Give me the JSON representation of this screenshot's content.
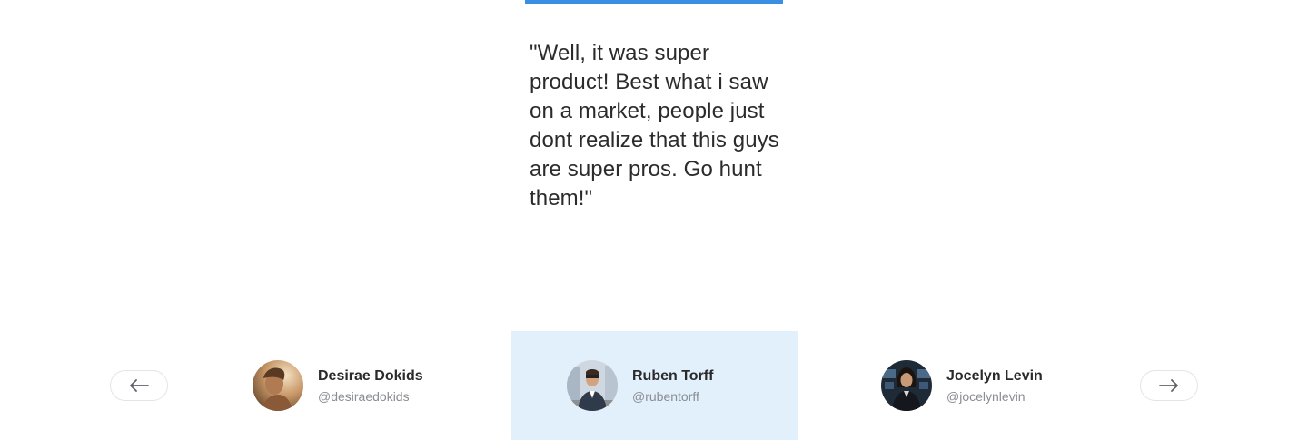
{
  "testimonial": {
    "quote": "\"Well, it was super product! Best what i saw on a market, people just dont realize that this guys are super pros. Go hunt them!\""
  },
  "navigation": {
    "prev_icon": "arrow-left-icon",
    "next_icon": "arrow-right-icon"
  },
  "people": [
    {
      "name": "Desirae Dokids",
      "handle": "@desiraedokids",
      "active": false
    },
    {
      "name": "Ruben Torff",
      "handle": "@rubentorff",
      "active": true
    },
    {
      "name": "Jocelyn Levin",
      "handle": "@jocelynlevin",
      "active": false
    }
  ],
  "colors": {
    "accent": "#3b8fe3",
    "active_background": "#e2f0fc"
  }
}
